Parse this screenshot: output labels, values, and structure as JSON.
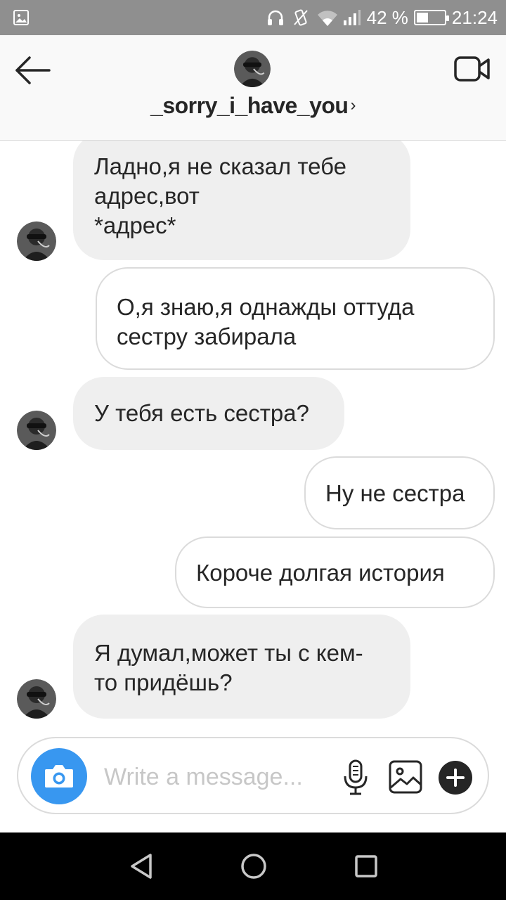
{
  "status_bar": {
    "battery_text": "42 %",
    "battery_level": 0.42,
    "time": "21:24",
    "icons": [
      "gallery-icon",
      "headphones-icon",
      "vibrate-icon",
      "wifi-icon",
      "signal-icon",
      "battery-icon"
    ]
  },
  "header": {
    "username": "_sorry_i_have_you",
    "chevron": "›",
    "back_icon": "arrow-left-icon",
    "video_icon": "video-camera-icon"
  },
  "messages": [
    {
      "direction": "incoming",
      "text": "Ладно,я не сказал тебе\nадрес,вот\n*адрес*",
      "show_avatar": true
    },
    {
      "direction": "outgoing",
      "text": "О,я знаю,я однажды оттуда\nсестру забирала"
    },
    {
      "direction": "incoming",
      "text": "У тебя есть сестра?",
      "show_avatar": true
    },
    {
      "direction": "outgoing",
      "text": "Ну не сестра"
    },
    {
      "direction": "outgoing",
      "text": "Короче долгая история"
    },
    {
      "direction": "incoming",
      "text": "Я думал,может ты с кем-\nто придёшь?",
      "show_avatar": true
    }
  ],
  "composer": {
    "placeholder": "Write a message...",
    "value": "",
    "icons": [
      "camera-icon",
      "microphone-icon",
      "gallery-icon",
      "plus-icon"
    ]
  },
  "navigation_bar": {
    "icons": [
      "back-triangle-icon",
      "home-circle-icon",
      "recents-square-icon"
    ]
  },
  "colors": {
    "status_bar": "#8f8f8f",
    "incoming_bubble": "#efefef",
    "outgoing_border": "#dbdbdb",
    "camera_button": "#3897f0",
    "nav_bar": "#000000"
  }
}
